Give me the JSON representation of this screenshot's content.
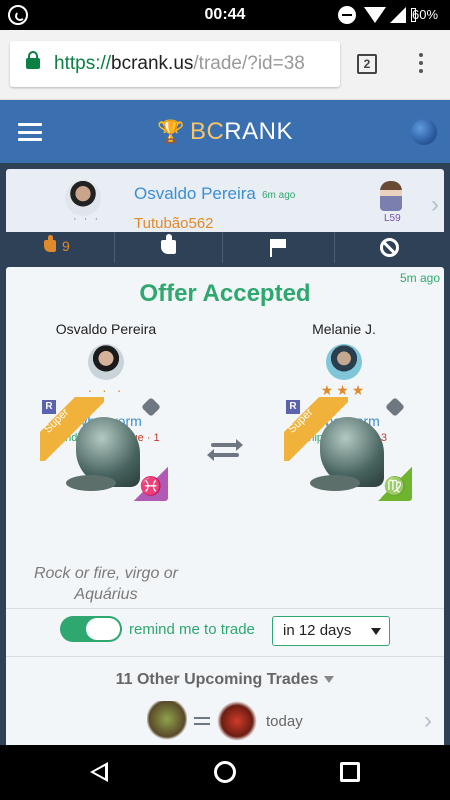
{
  "status_bar": {
    "time": "00:44",
    "battery": "60%"
  },
  "browser": {
    "url_scheme": "https://",
    "url_host": "bcrank.us",
    "url_path": "/trade/?id=38",
    "tab_count": "2"
  },
  "app": {
    "brand_prefix": "BC",
    "brand_suffix": "RANK"
  },
  "post": {
    "author": "Osvaldo Pereira",
    "time": "6m ago",
    "handle": "Tutubão562",
    "author_dots": "· · ·",
    "level": "L59",
    "likes": "9"
  },
  "trade": {
    "time": "5m ago",
    "status": "Offer Accepted",
    "left": {
      "user": "Osvaldo Pereira",
      "rating": "· · ·",
      "monster": "Cyborworm",
      "skill": "Windbane+",
      "rogue": "Rogue · 1",
      "rarity": "R",
      "tier": "Super",
      "sign": "♓"
    },
    "right": {
      "user": "Melanie J.",
      "rating": "★★★",
      "monster": "Cyborworm",
      "skill": "Snipe+",
      "rogue": "Rogue · 3",
      "rarity": "R",
      "tier": "Super",
      "sign": "♍"
    },
    "note": "Rock or fire, virgo or Aquárius",
    "remind_label": "remind me to trade",
    "remind_enabled": true,
    "remind_option": "in 12 days",
    "upcoming_label": "11 Other Upcoming Trades",
    "upcoming_when": "today"
  },
  "colors": {
    "accent_green": "#2ea86f",
    "link_blue": "#3a8fd4",
    "orange": "#e08a2a",
    "header_blue": "#3a6fb0",
    "dark_bg": "#2f4157"
  }
}
